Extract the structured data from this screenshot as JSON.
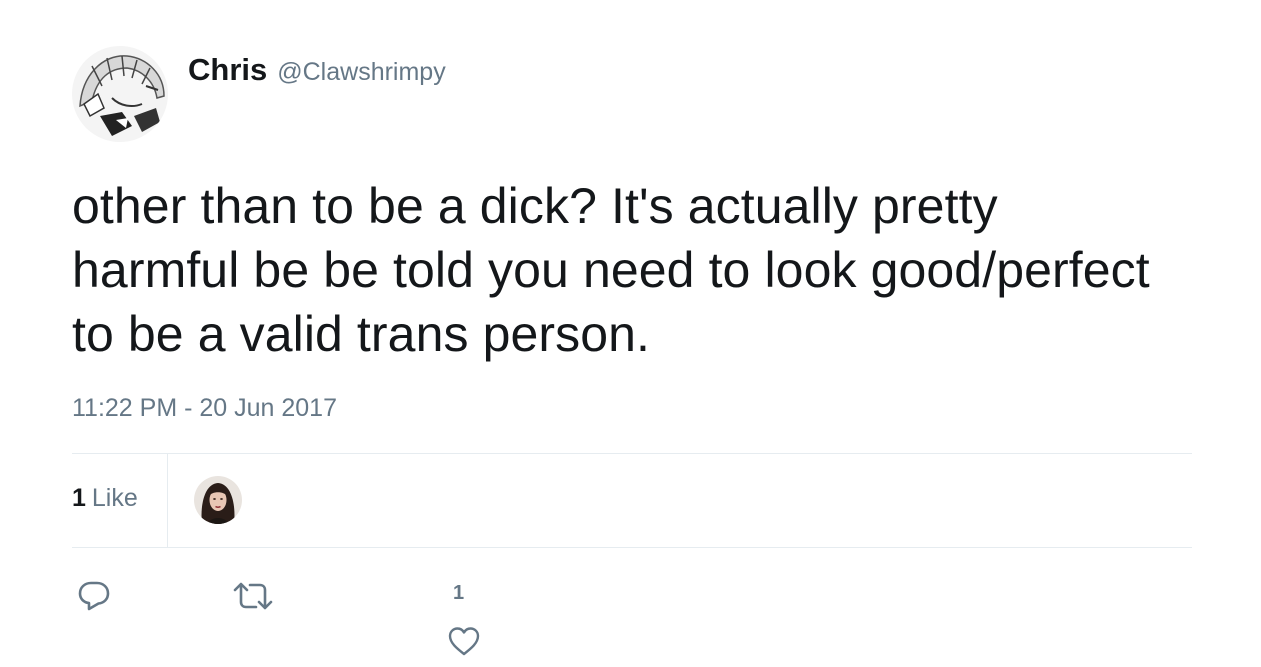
{
  "tweet": {
    "author": {
      "name": "Chris",
      "handle": "@Clawshrimpy",
      "avatar_icon": "anime-character-avatar"
    },
    "text": "other than to be a dick? It's actually pretty harmful be be told you need to look good/perfect to be a valid trans person.",
    "timestamp": "11:22 PM - 20 Jun 2017",
    "stats": {
      "like_count": "1",
      "like_label": "Like",
      "liker_avatar_icon": "user-photo-avatar"
    },
    "actions": {
      "reply_icon": "reply-icon",
      "retweet_icon": "retweet-icon",
      "like_icon": "heart-icon",
      "like_count": "1"
    }
  },
  "colors": {
    "text_primary": "#14171a",
    "text_secondary": "#657786",
    "divider": "#e6ecf0",
    "icon": "#657786"
  }
}
